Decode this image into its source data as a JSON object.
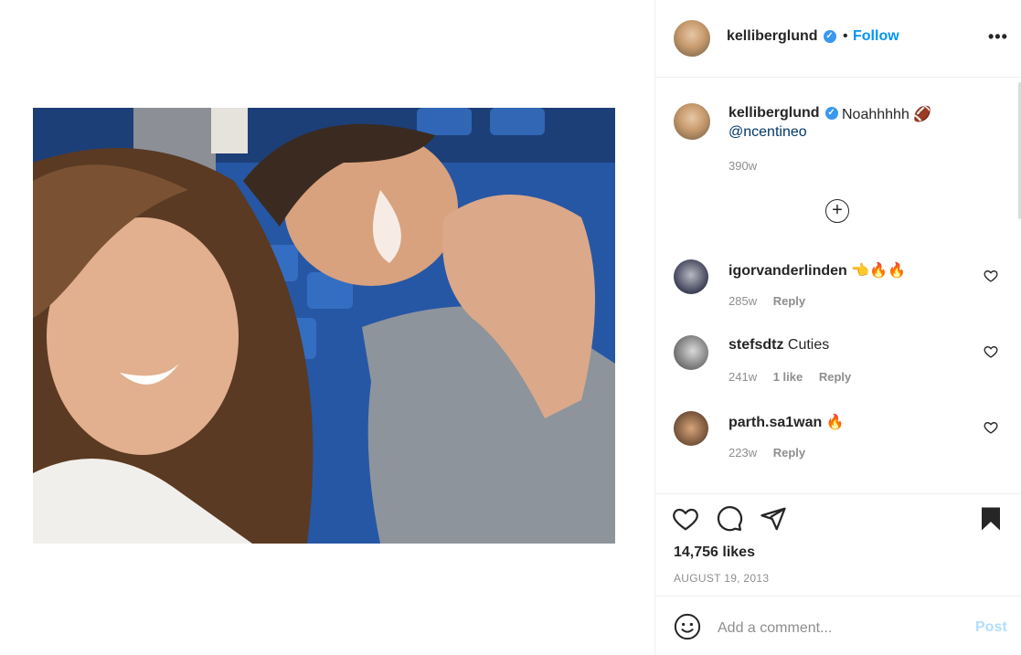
{
  "post": {
    "username": "kelliberglund",
    "follow_label": "Follow",
    "dot": "•",
    "more_label": "•••",
    "verified_mark": "✓"
  },
  "caption": {
    "username": "kelliberglund",
    "text": "Noahhhhh 🏈",
    "mention": "@ncentineo",
    "time": "390w",
    "load_more": "+"
  },
  "comments": [
    {
      "username": "igorvanderlinden",
      "text": "👈🔥🔥",
      "time": "285w",
      "likes": "",
      "reply": "Reply"
    },
    {
      "username": "stefsdtz",
      "text": "Cuties",
      "time": "241w",
      "likes": "1 like",
      "reply": "Reply"
    },
    {
      "username": "parth.sa1wan",
      "text": "🔥",
      "time": "223w",
      "likes": "",
      "reply": "Reply"
    }
  ],
  "actions": {
    "icons": [
      "heart-icon",
      "comment-icon",
      "share-icon",
      "bookmark-icon"
    ],
    "likes": "14,756 likes",
    "date": "AUGUST 19, 2013"
  },
  "composer": {
    "placeholder": "Add a comment...",
    "post_label": "Post"
  },
  "colors": {
    "link": "#0095f6",
    "mention": "#00376b",
    "muted": "#8e8e8e",
    "post_disabled": "#b2dffc"
  }
}
